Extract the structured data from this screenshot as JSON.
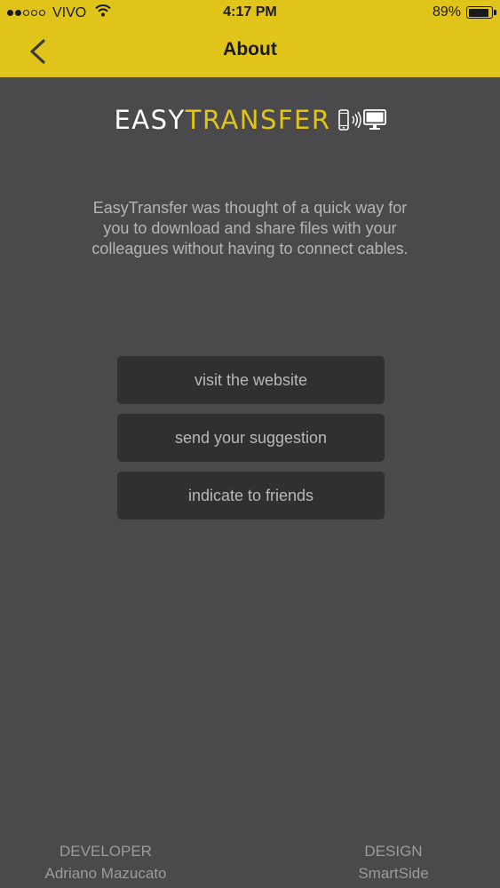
{
  "status_bar": {
    "signal_full": 2,
    "signal_total": 5,
    "carrier": "VIVO",
    "time": "4:17 PM",
    "battery_percent": "89%",
    "battery_level": 0.89
  },
  "nav": {
    "title": "About",
    "back_icon": "chevron-left-icon"
  },
  "logo": {
    "part1": "EASY",
    "part2": "TRANSFER",
    "icons": [
      "phone-icon",
      "signal-waves-icon",
      "monitor-icon"
    ]
  },
  "description": "EasyTransfer was thought of a quick way for you to download and share files with your colleagues without having to connect cables.",
  "buttons": {
    "website": "visit the website",
    "suggestion": "send your suggestion",
    "friends": "indicate to friends"
  },
  "credits": {
    "developer_label": "DEVELOPER",
    "developer_name": "Adriano Mazucato",
    "design_label": "DESIGN",
    "design_name": "SmartSide"
  },
  "colors": {
    "accent": "#e0c41a",
    "background": "#4a4a4c",
    "button": "#303032",
    "text_muted": "#b5b5b5"
  }
}
